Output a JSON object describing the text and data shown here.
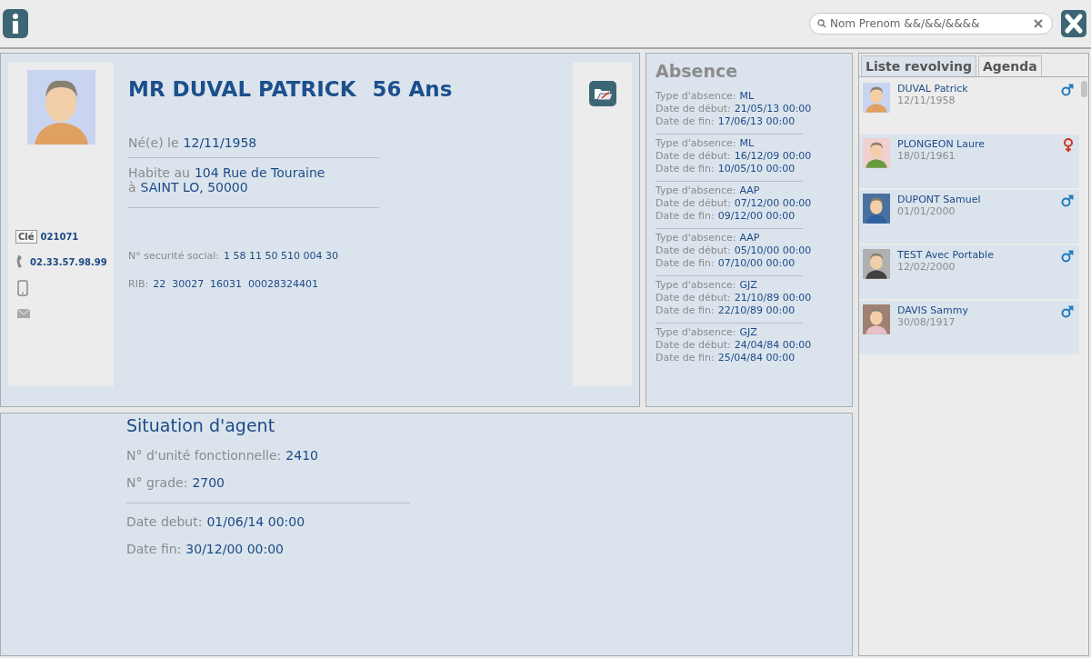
{
  "toolbar": {
    "search": {
      "placeholder": "Nom Prenom &&/&&/&&&&"
    }
  },
  "profile": {
    "title": "MR DUVAL PATRICK",
    "age": "56 Ans",
    "key": {
      "label": "Clé",
      "value": "021071"
    },
    "phone": "02.33.57.98.99",
    "birth": {
      "label": "Né(e) le",
      "value": "12/11/1958"
    },
    "address": [
      {
        "label": "Habite au",
        "value": "104 Rue de Touraine"
      },
      {
        "label": "à",
        "value": "SAINT LO, 50000"
      }
    ],
    "ids": [
      {
        "label": "N° securité social:",
        "value": "1 58 11 50 510 004 30"
      },
      {
        "label": "RIB:",
        "value": "22  30027  16031  00028324401"
      }
    ]
  },
  "absence": {
    "title": "Absence",
    "entries": [
      {
        "fields": [
          {
            "label": "Type d'absence:",
            "value": "ML"
          },
          {
            "label": "Date de début:",
            "value": "21/05/13 00:00"
          },
          {
            "label": "Date de fin:",
            "value": "17/06/13 00:00"
          }
        ]
      },
      {
        "fields": [
          {
            "label": "Type d'absence:",
            "value": "ML"
          },
          {
            "label": "Date de début:",
            "value": "16/12/09 00:00"
          },
          {
            "label": "Date de fin:",
            "value": "10/05/10 00:00"
          }
        ]
      },
      {
        "fields": [
          {
            "label": "Type d'absence:",
            "value": "AAP"
          },
          {
            "label": "Date de début:",
            "value": "07/12/00 00:00"
          },
          {
            "label": "Date de fin:",
            "value": "09/12/00 00:00"
          }
        ]
      },
      {
        "fields": [
          {
            "label": "Type d'absence:",
            "value": "AAP"
          },
          {
            "label": "Date de début:",
            "value": "05/10/00 00:00"
          },
          {
            "label": "Date de fin:",
            "value": "07/10/00 00:00"
          }
        ]
      },
      {
        "fields": [
          {
            "label": "Type d'absence:",
            "value": "GJZ"
          },
          {
            "label": "Date de début:",
            "value": "21/10/89 00:00"
          },
          {
            "label": "Date de fin:",
            "value": "22/10/89 00:00"
          }
        ]
      },
      {
        "fields": [
          {
            "label": "Type d'absence:",
            "value": "GJZ"
          },
          {
            "label": "Date de début:",
            "value": "24/04/84 00:00"
          },
          {
            "label": "Date de fin:",
            "value": "25/04/84 00:00"
          }
        ]
      }
    ]
  },
  "situation": {
    "title": "Situation d'agent",
    "groups": [
      [
        {
          "label": "N° d'unité fonctionnelle:",
          "value": "2410"
        },
        {
          "label": "N° grade:",
          "value": "2700"
        }
      ],
      [
        {
          "label": "Date debut:",
          "value": "01/06/14 00:00"
        },
        {
          "label": "Date fin:",
          "value": "30/12/00 00:00"
        }
      ]
    ]
  },
  "tabs": [
    {
      "label": "Liste revolving",
      "selected": true
    },
    {
      "label": "Agenda",
      "selected": false
    }
  ],
  "people": [
    {
      "name": "DUVAL Patrick",
      "date": "12/11/1958",
      "kind": "male",
      "selected": true
    },
    {
      "name": "PLONGEON Laure",
      "date": "18/01/1961",
      "kind": "female",
      "selected": false
    },
    {
      "name": "DUPONT Samuel",
      "date": "01/01/2000",
      "kind": "male",
      "selected": false
    },
    {
      "name": "TEST Avec Portable",
      "date": "12/02/2000",
      "kind": "male",
      "selected": false
    },
    {
      "name": "DAVIS Sammy",
      "date": "30/08/1917",
      "kind": "male",
      "selected": false
    }
  ]
}
